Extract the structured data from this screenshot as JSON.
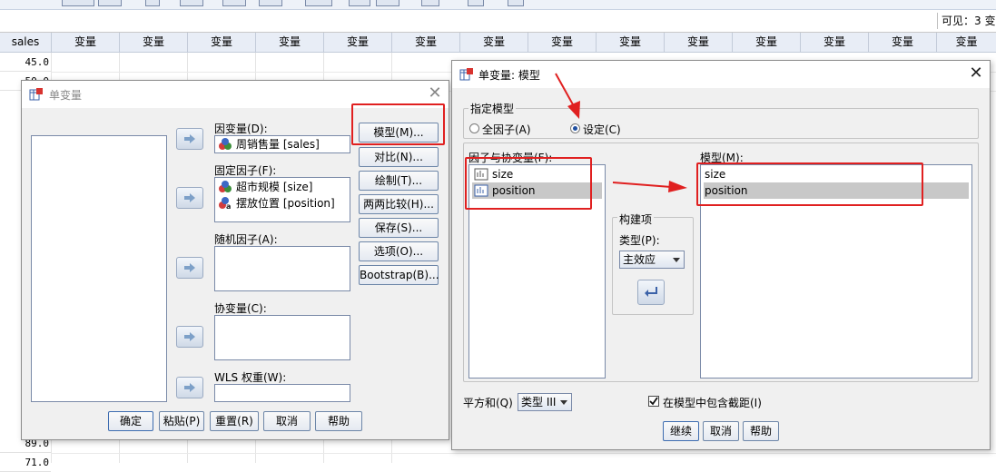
{
  "spreadsheet": {
    "visible_count": "可见：3 变",
    "first_column_header": "sales",
    "column_header": "变量",
    "rows": [
      {
        "value": "45.0"
      },
      {
        "value": "50.0"
      },
      {
        "value": "89.0"
      },
      {
        "value": "71.0"
      }
    ]
  },
  "univariate_dialog": {
    "title": "单变量",
    "dependent": {
      "label": "因变量(D):",
      "value": "周销售量 [sales]"
    },
    "fixed_factors": {
      "label": "固定因子(F):",
      "items": [
        "超市规模 [size]",
        "摆放位置 [position]"
      ]
    },
    "random_factors": {
      "label": "随机因子(A):"
    },
    "covariates": {
      "label": "协变量(C):"
    },
    "wls": {
      "label": "WLS 权重(W):"
    },
    "side_buttons": [
      "模型(M)...",
      "对比(N)...",
      "绘制(T)...",
      "两两比较(H)...",
      "保存(S)...",
      "选项(O)...",
      "Bootstrap(B)..."
    ],
    "bottom_buttons": [
      "确定",
      "粘贴(P)",
      "重置(R)",
      "取消",
      "帮助"
    ]
  },
  "model_dialog": {
    "title": "单变量: 模型",
    "specify_group_label": "指定模型",
    "radio_full": "全因子(A)",
    "radio_custom": "设定(C)",
    "factors_label": "因子与协变量(F):",
    "factors": [
      "size",
      "position"
    ],
    "model_label": "模型(M):",
    "model_terms": [
      "size",
      "position"
    ],
    "build_group_label": "构建项",
    "type_label": "类型(P):",
    "type_value": "主效应",
    "sum_squares_label": "平方和(Q)",
    "sum_squares_value": "类型 III",
    "include_intercept": "在模型中包含截距(I)",
    "buttons": [
      "继续",
      "取消",
      "帮助"
    ]
  },
  "colors": {
    "accent_red": "#e02020",
    "selection": "#c8c8c8",
    "dialog_bg": "#f0f0f0"
  }
}
